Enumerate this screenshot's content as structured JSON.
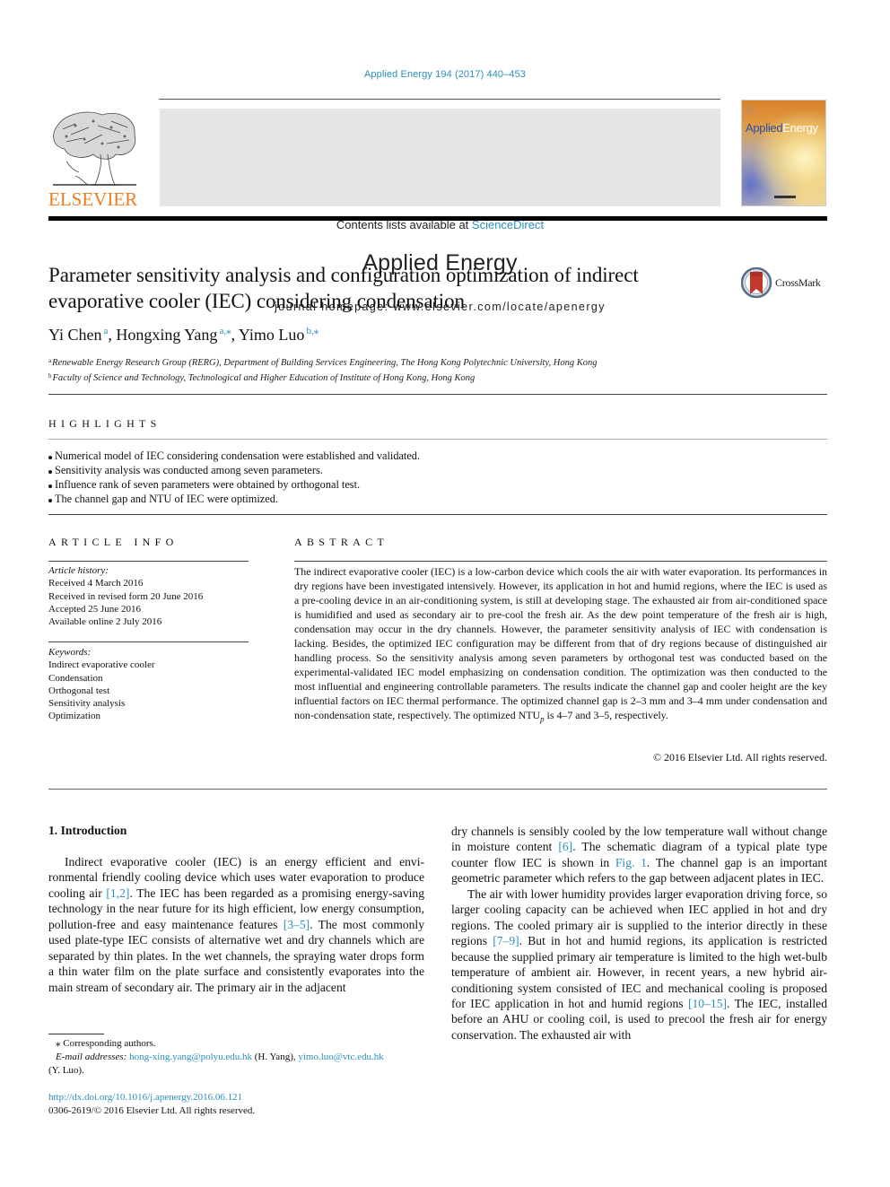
{
  "journal_citation": "Applied Energy 194 (2017) 440–453",
  "masthead": {
    "contents_prefix": "Contents lists available at ",
    "contents_link": "ScienceDirect",
    "journal_name": "Applied Energy",
    "homepage": "journal homepage: www.elsevier.com/locate/apenergy",
    "publisher_logo_text": "ELSEVIER",
    "cover_title_part1": "Applied",
    "cover_title_part2": "Energy",
    "brand_orange": "#f07c1d",
    "link_color": "#2a8fbd"
  },
  "title": {
    "line1": "Parameter sensitivity analysis and configuration optimization of indirect",
    "line2": "evaporative cooler (IEC) considering condensation",
    "crossmark_label": "CrossMark"
  },
  "authors": [
    {
      "name": "Yi Chen",
      "sup": "a",
      "sep": ", "
    },
    {
      "name": "Hongxing Yang",
      "sup": "a,⁎",
      "sep": ", "
    },
    {
      "name": "Yimo Luo",
      "sup": "b,⁎",
      "sep": ""
    }
  ],
  "affiliations": [
    {
      "key": "a",
      "text": "Renewable Energy Research Group (RERG), Department of Building Services Engineering, The Hong Kong Polytechnic University, Hong Kong"
    },
    {
      "key": "b",
      "text": "Faculty of Science and Technology, Technological and Higher Education of Institute of Hong Kong, Hong Kong"
    }
  ],
  "highlights": {
    "heading": "HIGHLIGHTS",
    "items": [
      "Numerical model of IEC considering condensation were established and validated.",
      "Sensitivity analysis was conducted among seven parameters.",
      "Influence rank of seven parameters were obtained by orthogonal test.",
      "The channel gap and NTU of IEC were optimized."
    ]
  },
  "article_info": {
    "heading": "ARTICLE INFO",
    "history_label": "Article history:",
    "history": [
      "Received 4 March 2016",
      "Received in revised form 20 June 2016",
      "Accepted 25 June 2016",
      "Available online 2 July 2016"
    ],
    "keywords_label": "Keywords:",
    "keywords": [
      "Indirect evaporative cooler",
      "Condensation",
      "Orthogonal test",
      "Sensitivity analysis",
      "Optimization"
    ]
  },
  "abstract": {
    "heading": "ABSTRACT",
    "text_before_sub": "The indirect evaporative cooler (IEC) is a low-carbon device which cools the air with water evaporation. Its performances in dry regions have been investigated intensively. However, its application in hot and humid regions, where the IEC is used as a pre-cooling device in an air-conditioning system, is still at developing stage. The exhausted air from air-conditioned space is humidified and used as secondary air to pre-cool the fresh air. As the dew point temperature of the fresh air is high, condensation may occur in the dry channels. However, the parameter sensitivity analysis of IEC with condensation is lacking. Besides, the optimized IEC configuration may be different from that of dry regions because of distin­guished air handling process. So the sensitivity analysis among seven parameters by orthogonal test was conducted based on the experimental-validated IEC model emphasizing on condensation condition. The optimization was then conducted to the most influential and engineering controllable parameters. The results indicate the channel gap and cooler height are the key influential factors on IEC thermal per­formance. The optimized channel gap is 2–3 mm and 3–4 mm under condensation and non-condensation state, respectively. The optimized NTU",
    "sub": "p",
    "text_after_sub": " is 4–7 and 3–5, respectively.",
    "copyright": "© 2016 Elsevier Ltd. All rights reserved."
  },
  "introduction": {
    "heading": "1. Introduction",
    "left_para": [
      {
        "t": "Indirect evaporative cooler (IEC) is an energy efficient and envi­ronmental friendly cooling device which uses water evaporation to produce cooling air "
      },
      {
        "ref": "[1,2]"
      },
      {
        "t": ". The IEC has been regarded as a promising energy-saving technology in the near future for its high efficient, low energy consumption, pollution-free and easy maintenance fea­tures "
      },
      {
        "ref": "[3–5]"
      },
      {
        "t": ". The most commonly used plate-type IEC consists of alternative wet and dry channels which are separated by thin plates. In the wet channels, the spraying water drops form a thin water film on the plate surface and consistently evaporates into the main stream of secondary air. The primary air in the adjacent"
      }
    ],
    "right_para1": [
      {
        "t": "dry channels is sensibly cooled by the low temperature wall with­out change in moisture content "
      },
      {
        "ref": "[6]"
      },
      {
        "t": ". The schematic diagram of a typical plate type counter flow IEC is shown in "
      },
      {
        "ref": "Fig. 1"
      },
      {
        "t": ". The channel gap is an important geometric parameter which refers to the gap between adjacent plates in IEC."
      }
    ],
    "right_para2": [
      {
        "t": "The air with lower humidity provides larger evaporation driving force, so larger cooling capacity can be achieved when IEC applied in hot and dry regions. The cooled primary air is supplied to the interior directly in these regions "
      },
      {
        "ref": "[7–9]"
      },
      {
        "t": ". But in hot and humid regions, its application is restricted because the supplied primary air temperature is limited to the high wet-bulb temperature of ambient air. However, in recent years, a new hybrid air-conditioning system consisted of IEC and mechanical cooling is proposed for IEC application in hot and humid regions "
      },
      {
        "ref": "[10–15]"
      },
      {
        "t": ". The IEC, installed before an AHU or cooling coil, is used to pre­cool the fresh air for energy conservation. The exhausted air with"
      }
    ]
  },
  "footnotes": {
    "corresponding": "⁎ Corresponding authors.",
    "email_label": "E-mail addresses: ",
    "email1": "hong-xing.yang@polyu.edu.hk",
    "email1_owner": " (H. Yang), ",
    "email2": "yimo.luo@vtc.edu.hk",
    "email2_owner": "(Y. Luo).",
    "doi": "http://dx.doi.org/10.1016/j.apenergy.2016.06.121",
    "issn_copyright": "0306-2619/© 2016 Elsevier Ltd. All rights reserved."
  }
}
